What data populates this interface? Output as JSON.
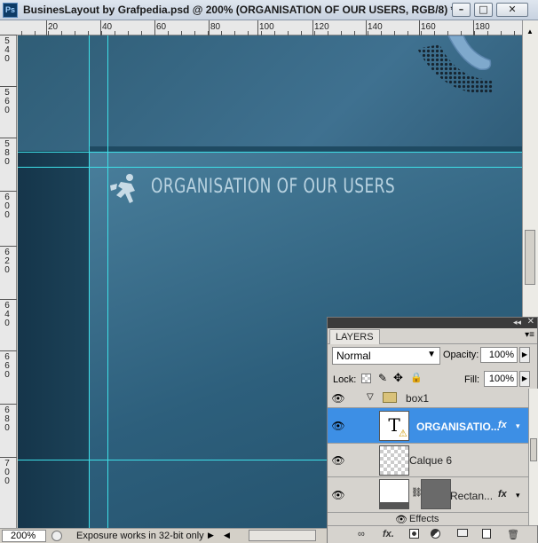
{
  "window": {
    "app_icon": "Ps",
    "title": "BusinesLayout by Grafpedia.psd @ 200% (ORGANISATION OF OUR USERS, RGB/8) *"
  },
  "ruler": {
    "top_labels": [
      "20",
      "40",
      "60",
      "80",
      "100",
      "120",
      "140",
      "160",
      "180"
    ],
    "left_labels": [
      "540",
      "560",
      "580",
      "600",
      "620",
      "640",
      "660",
      "680",
      "700"
    ]
  },
  "canvas": {
    "header_text": "ORGANISATION OF OUR USERS"
  },
  "status": {
    "zoom": "200%",
    "message": "Exposure works in 32-bit only"
  },
  "layers_panel": {
    "tab": "LAYERS",
    "blend_mode": "Normal",
    "opacity_label": "Opacity:",
    "opacity": "100%",
    "lock_label": "Lock:",
    "fill_label": "Fill:",
    "fill": "100%",
    "group_name": "box1",
    "layers": [
      {
        "name": "ORGANISATIO...",
        "thumb": "T",
        "selected": true,
        "fx": "fx"
      },
      {
        "name": "Calque 6",
        "thumb": "transparent",
        "selected": false
      },
      {
        "name": "Rectan...",
        "thumb": "rect",
        "selected": false,
        "fx": "fx"
      }
    ],
    "effects_label": "Effects"
  }
}
